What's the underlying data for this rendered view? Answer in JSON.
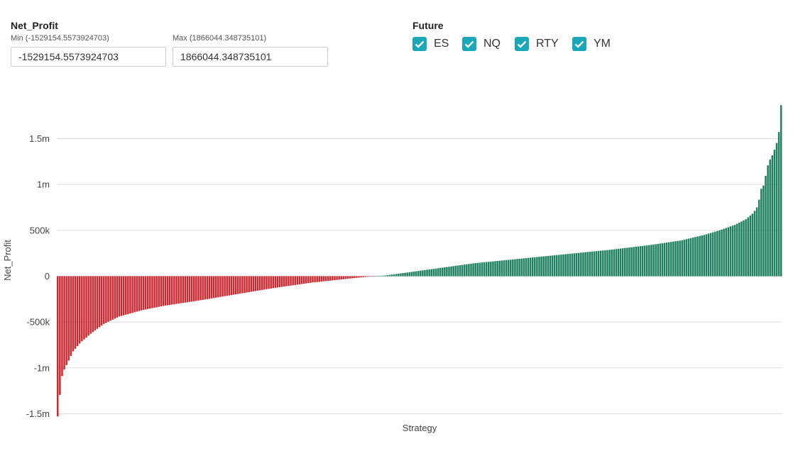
{
  "filter": {
    "title": "Net_Profit",
    "min_label": "Min (-1529154.5573924703)",
    "max_label": "Max (1866044.348735101)",
    "min_value": "-1529154.5573924703",
    "max_value": "1866044.348735101"
  },
  "future": {
    "title": "Future",
    "options": [
      {
        "label": "ES",
        "checked": true
      },
      {
        "label": "NQ",
        "checked": true
      },
      {
        "label": "RTY",
        "checked": true
      },
      {
        "label": "YM",
        "checked": true
      }
    ],
    "checkbox_color": "#1aa7b8"
  },
  "colors": {
    "positive": "#1e8060",
    "negative": "#cc2a30",
    "grid": "#dddddd"
  },
  "chart_data": {
    "type": "bar",
    "xlabel": "Strategy",
    "ylabel": "Net_Profit",
    "ylim": [
      -1529154.56,
      1866044.35
    ],
    "yticks": [
      -1500000,
      -1000000,
      -500000,
      0,
      500000,
      1000000,
      1500000
    ],
    "ytick_labels": [
      "-1.5m",
      "-1m",
      "-500k",
      "0",
      "500k",
      "1m",
      "1.5m"
    ],
    "grid": true,
    "sorted": "ascending",
    "bar_count": 330,
    "anchors": [
      [
        0,
        -1529154.56
      ],
      [
        1,
        -1320000
      ],
      [
        2,
        -1260000
      ],
      [
        3,
        -1060000
      ],
      [
        6,
        -960000
      ],
      [
        10,
        -820000
      ],
      [
        15,
        -720000
      ],
      [
        22,
        -620000
      ],
      [
        30,
        -520000
      ],
      [
        40,
        -440000
      ],
      [
        55,
        -370000
      ],
      [
        70,
        -320000
      ],
      [
        90,
        -270000
      ],
      [
        115,
        -200000
      ],
      [
        140,
        -130000
      ],
      [
        165,
        -70000
      ],
      [
        190,
        -25000
      ],
      [
        205,
        0
      ],
      [
        213,
        8000
      ],
      [
        240,
        70000
      ],
      [
        270,
        140000
      ],
      [
        300,
        190000
      ],
      [
        330,
        240000
      ],
      [
        360,
        290000
      ],
      [
        385,
        340000
      ],
      [
        405,
        390000
      ],
      [
        420,
        450000
      ],
      [
        430,
        500000
      ],
      [
        440,
        560000
      ],
      [
        447,
        620000
      ],
      [
        452,
        690000
      ],
      [
        455,
        770000
      ],
      [
        457,
        950000
      ],
      [
        459,
        1000000
      ],
      [
        461,
        1190000
      ],
      [
        463,
        1280000
      ],
      [
        465,
        1340000
      ],
      [
        467,
        1450000
      ],
      [
        468,
        1470000
      ],
      [
        469,
        1650000
      ],
      [
        470,
        1866044.35
      ]
    ]
  }
}
